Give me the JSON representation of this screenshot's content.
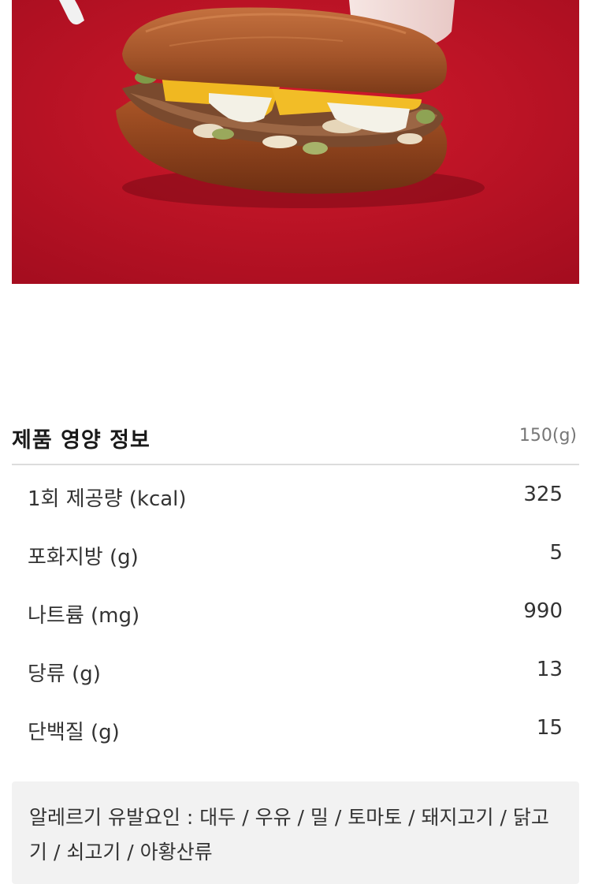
{
  "hero_image": {
    "subject": "sandwich-photo",
    "background_color": "#c8102e"
  },
  "nutrition": {
    "title": "제품 영양 정보",
    "serving": "150(g)",
    "rows": [
      {
        "label": "1회 제공량 (kcal)",
        "value": "325"
      },
      {
        "label": "포화지방 (g)",
        "value": "5"
      },
      {
        "label": "나트륨 (mg)",
        "value": "990"
      },
      {
        "label": "당류 (g)",
        "value": "13"
      },
      {
        "label": "단백질 (g)",
        "value": "15"
      }
    ]
  },
  "allergy": {
    "text": "알레르기 유발요인 : 대두 / 우유 / 밀 / 토마토 / 돼지고기 / 닭고기 / 쇠고기 / 아황산류"
  }
}
